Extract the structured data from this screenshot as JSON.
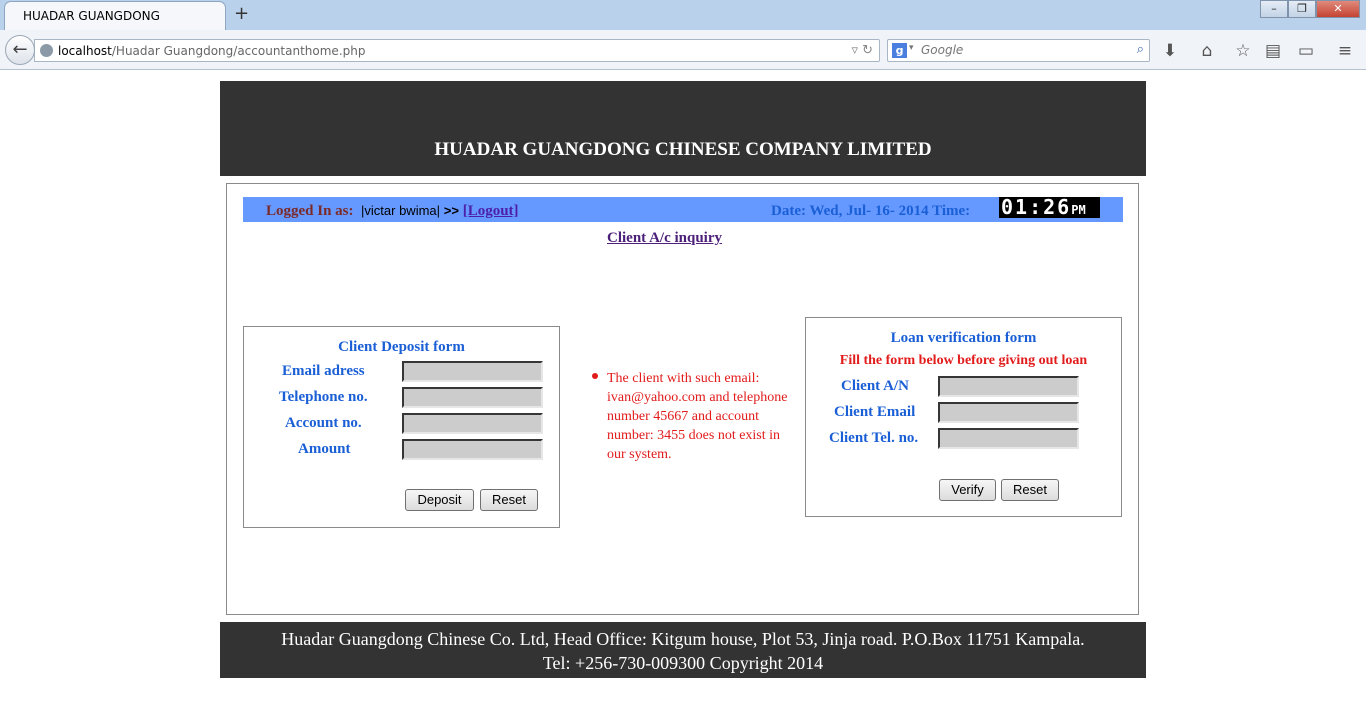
{
  "browser": {
    "tab_title": "HUADAR GUANGDONG",
    "new_tab": "+",
    "url_host": "localhost",
    "url_path": "/Huadar Guangdong/accountanthome.php",
    "search_placeholder": "Google",
    "window_buttons": {
      "minimize": "–",
      "restore": "❐",
      "close": "✕"
    }
  },
  "header": {
    "company": "HUADAR GUANGDONG CHINESE COMPANY LIMITED"
  },
  "infobar": {
    "logged_in_label": "Logged In as:",
    "user": "|victar  bwima|",
    "separator": ">>",
    "logout": "[Logout]",
    "date_label": "Date: Wed, Jul- 16- 2014 Time:",
    "clock_time": "01:26",
    "clock_ampm": "PM"
  },
  "inquiry_link": "Client A/c inquiry",
  "deposit_form": {
    "title": "Client Deposit form",
    "fields": [
      {
        "label": "Email adress",
        "value": ""
      },
      {
        "label": "Telephone no.",
        "value": ""
      },
      {
        "label": "Account no.",
        "value": ""
      },
      {
        "label": "Amount",
        "value": ""
      }
    ],
    "deposit_button": "Deposit",
    "reset_button": "Reset"
  },
  "message": {
    "text": "The client with such email: ivan@yahoo.com and telephone number 45667 and account number: 3455 does not exist in our system.",
    "color": "#e21b1b"
  },
  "loan_form": {
    "title": "Loan verification form",
    "warning": "Fill the form below before giving out loan",
    "fields": [
      {
        "label": "Client A/N",
        "value": ""
      },
      {
        "label": "Client Email",
        "value": ""
      },
      {
        "label": "Client Tel. no.",
        "value": ""
      }
    ],
    "verify_button": "Verify",
    "reset_button": "Reset"
  },
  "footer": {
    "line1": "Huadar Guangdong Chinese Co. Ltd, Head Office: Kitgum house, Plot 53, Jinja road. P.O.Box 11751 Kampala.",
    "line2": "Tel: +256-730-009300 Copyright 2014"
  },
  "colors": {
    "banner": "#333333",
    "infobar": "#6699ff",
    "label_blue": "#1a5fd6",
    "error_red": "#e21b1b"
  }
}
